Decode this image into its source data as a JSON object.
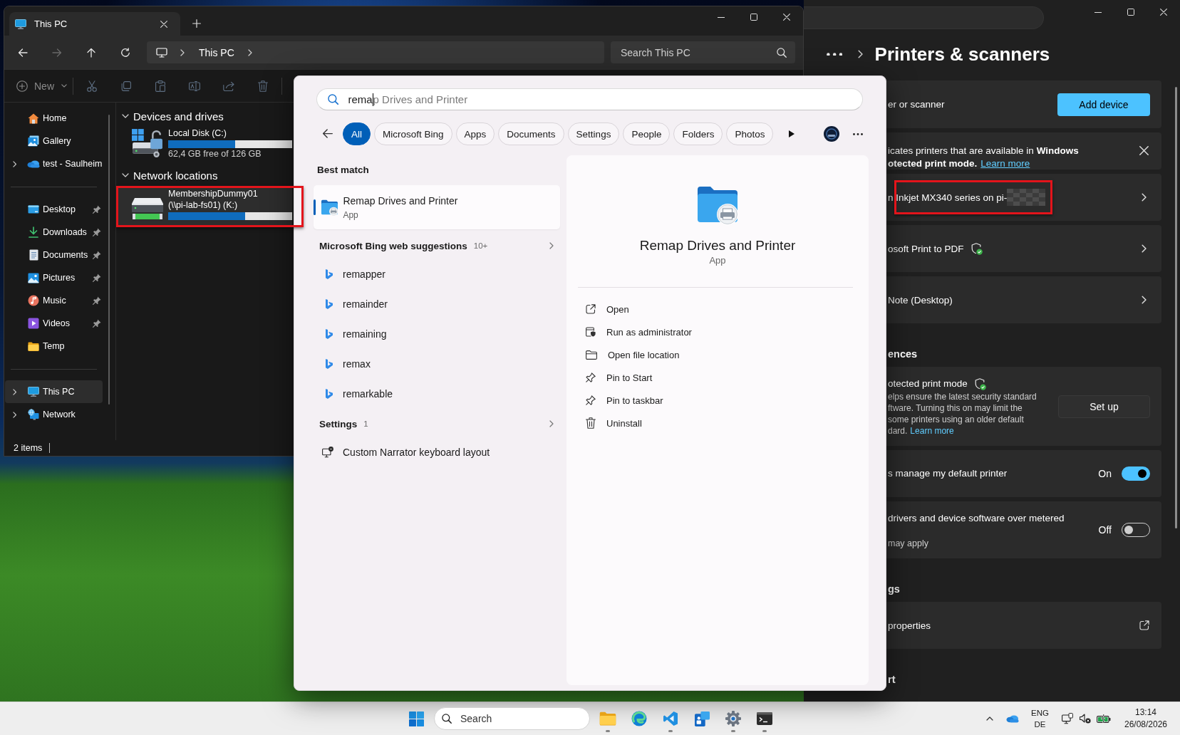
{
  "explorer": {
    "tab": {
      "title": "This PC"
    },
    "nav_buttons": [
      {
        "disabled": false
      },
      {
        "disabled": true
      },
      {
        "disabled": false
      },
      {
        "disabled": false
      }
    ],
    "address": {
      "crumbs": [
        "This PC"
      ]
    },
    "search": {
      "placeholder": "Search This PC"
    },
    "new_button": {
      "label": "New",
      "disabled": true
    },
    "commands": [
      {
        "disabled": true
      },
      {
        "disabled": true
      },
      {
        "disabled": true
      },
      {
        "disabled": true
      },
      {
        "disabled": true
      },
      {
        "disabled": true
      }
    ],
    "sidebar": {
      "sections": [
        {
          "items": [
            {
              "label": "Home",
              "expandable": false,
              "pinned": false,
              "selected": false
            },
            {
              "label": "Gallery",
              "expandable": false,
              "pinned": false,
              "selected": false
            },
            {
              "label": "test - Saulheim",
              "expandable": true,
              "pinned": false,
              "selected": false
            }
          ]
        },
        {
          "items": [
            {
              "label": "Desktop",
              "expandable": false,
              "pinned": true,
              "selected": false
            },
            {
              "label": "Downloads",
              "expandable": false,
              "pinned": true,
              "selected": false
            },
            {
              "label": "Documents",
              "expandable": false,
              "pinned": true,
              "selected": false
            },
            {
              "label": "Pictures",
              "expandable": false,
              "pinned": true,
              "selected": false
            },
            {
              "label": "Music",
              "expandable": false,
              "pinned": true,
              "selected": false
            },
            {
              "label": "Videos",
              "expandable": false,
              "pinned": true,
              "selected": false
            },
            {
              "label": "Temp",
              "expandable": false,
              "pinned": false,
              "selected": false
            }
          ]
        },
        {
          "items": [
            {
              "label": "This PC",
              "expandable": true,
              "pinned": false,
              "selected": true
            },
            {
              "label": "Network",
              "expandable": true,
              "pinned": false,
              "selected": false
            }
          ]
        }
      ]
    },
    "groups": [
      {
        "title": "Devices and drives",
        "expanded": true,
        "drives": [
          {
            "kind": "local",
            "name": "Local Disk (C:)",
            "detail": "62,4 GB free of 126 GB",
            "level": 0.54,
            "selected": false,
            "highlighted": false
          }
        ]
      },
      {
        "title": "Network locations",
        "expanded": true,
        "drives": [
          {
            "kind": "network",
            "name": "MembershipDummy01",
            "detail": "(\\\\pi-lab-fs01) (K:)",
            "level": 0.62,
            "selected": true,
            "highlighted": true
          }
        ]
      }
    ],
    "status_bar": {
      "item_count": "2 items"
    }
  },
  "search_panel": {
    "query": {
      "value": "rema",
      "completion": "p Drives and Printer"
    },
    "filters": [
      {
        "label": "All",
        "selected": true
      },
      {
        "label": "Microsoft Bing",
        "selected": false
      },
      {
        "label": "Apps",
        "selected": false
      },
      {
        "label": "Documents",
        "selected": false
      },
      {
        "label": "Settings",
        "selected": false
      },
      {
        "label": "People",
        "selected": false
      },
      {
        "label": "Folders",
        "selected": false
      },
      {
        "label": "Photos",
        "selected": false
      }
    ],
    "best_match": {
      "heading": "Best match",
      "title": "Remap Drives and Printer",
      "type": "App",
      "selected": true
    },
    "sections": [
      {
        "kind": "web",
        "heading": "Microsoft Bing web suggestions",
        "count": "10+",
        "items": [
          "remapper",
          "remainder",
          "remaining",
          "remax",
          "remarkable"
        ]
      },
      {
        "kind": "settings",
        "heading": "Settings",
        "count": "1",
        "items": [
          "Custom Narrator keyboard layout"
        ]
      }
    ],
    "detail": {
      "title": "Remap Drives and Printer",
      "type": "App",
      "actions": [
        "Open",
        "Run as administrator",
        "Open file location",
        "Pin to Start",
        "Pin to taskbar",
        "Uninstall"
      ]
    }
  },
  "settings": {
    "title": "Printers & scanners",
    "add_card": {
      "text": "er or scanner",
      "button": "Add device"
    },
    "notice": {
      "lines": [
        "icates printers that are available in **Windows**",
        "**otected print mode.**"
      ],
      "link": "Learn more"
    },
    "printers": [
      {
        "name": "n Inkjet MX340 series on pi-",
        "redacted": true,
        "protected": false,
        "highlighted": true
      },
      {
        "name": "osoft Print to PDF",
        "redacted": false,
        "protected": true,
        "highlighted": false
      },
      {
        "name": "Note (Desktop)",
        "redacted": false,
        "protected": false,
        "highlighted": false
      }
    ],
    "sections": [
      {
        "heading": "ences",
        "cards": [
          {
            "kind": "button",
            "title": "otected print mode",
            "protected": true,
            "lines": [
              "elps ensure the latest security standard",
              "ftware. Turning this on may limit the",
              "some printers using an older default",
              "dard."
            ],
            "link": "Learn more",
            "button": "Set up"
          },
          {
            "kind": "toggle",
            "title": "s manage my default printer",
            "state_label": "On",
            "on": true
          },
          {
            "kind": "toggle",
            "title": "drivers and device software over metered",
            "subtitle": "may apply",
            "state_label": "Off",
            "on": false
          }
        ]
      },
      {
        "heading": "gs",
        "cards": [
          {
            "kind": "link",
            "title": "properties"
          }
        ]
      },
      {
        "heading": "rt"
      }
    ]
  },
  "taskbar": {
    "search_placeholder": "Search",
    "apps": [
      {
        "running": true
      },
      {
        "running": false
      },
      {
        "running": true
      },
      {
        "running": false
      },
      {
        "running": true
      },
      {
        "running": true
      }
    ],
    "language": {
      "input": "ENG",
      "layout": "DE"
    },
    "clock": {
      "time": "13:14",
      "date": "26/08/2026"
    }
  }
}
